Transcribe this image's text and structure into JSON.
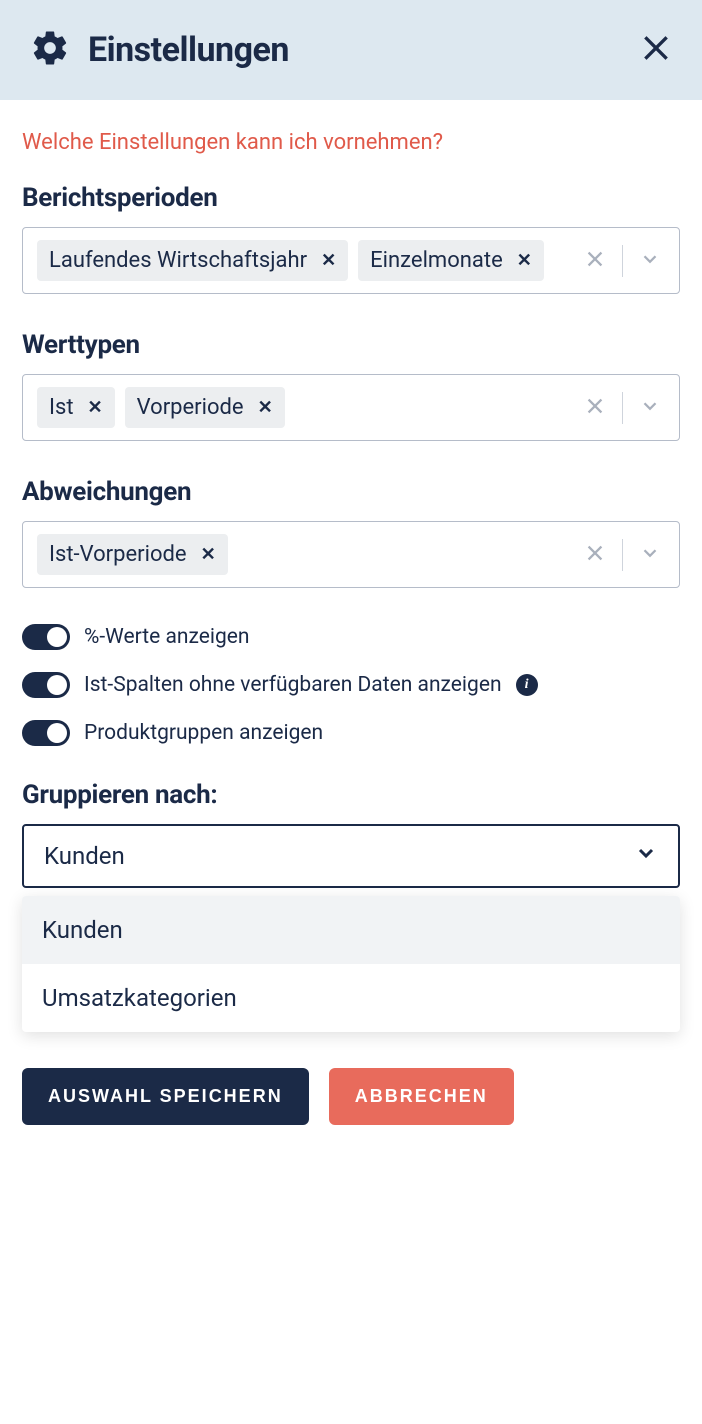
{
  "header": {
    "title": "Einstellungen"
  },
  "help_link": "Welche Einstellungen kann ich vornehmen?",
  "sections": {
    "reporting_periods": {
      "label": "Berichtsperioden",
      "chips": [
        "Laufendes Wirtschaftsjahr",
        "Einzelmonate"
      ]
    },
    "value_types": {
      "label": "Werttypen",
      "chips": [
        "Ist",
        "Vorperiode"
      ]
    },
    "deviations": {
      "label": "Abweichungen",
      "chips": [
        "Ist-Vorperiode"
      ]
    }
  },
  "toggles": {
    "percent": "%-Werte anzeigen",
    "ist_columns": "Ist-Spalten ohne verfügbaren Daten anzeigen",
    "product_groups": "Produktgruppen anzeigen"
  },
  "group_by": {
    "label": "Gruppieren nach:",
    "selected": "Kunden",
    "options": [
      "Kunden",
      "Umsatzkategorien"
    ]
  },
  "footer": {
    "save": "AUSWAHL SPEICHERN",
    "cancel": "ABBRECHEN"
  }
}
